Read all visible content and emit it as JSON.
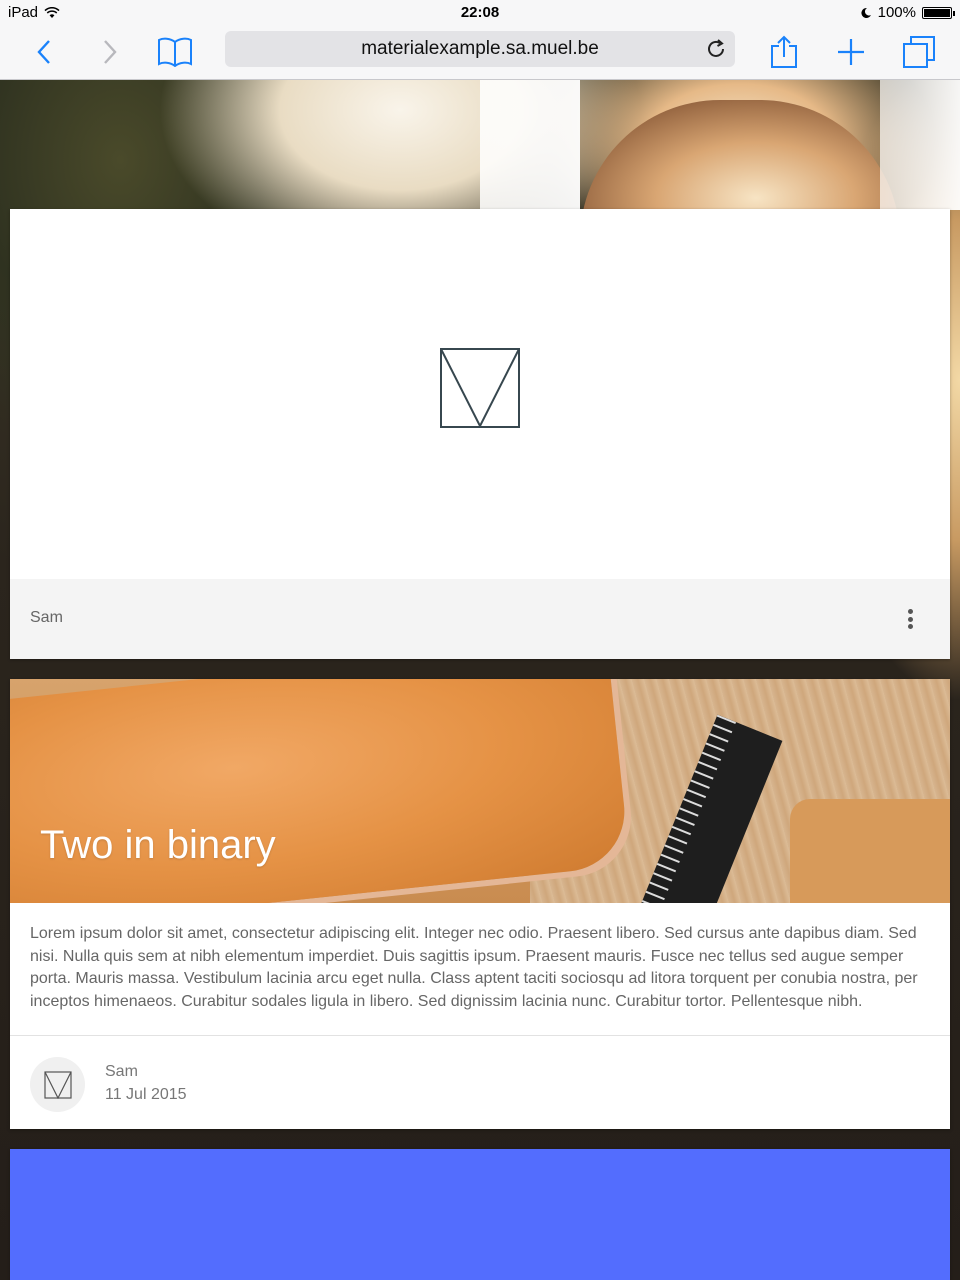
{
  "status_bar": {
    "device": "iPad",
    "time": "22:08",
    "battery": "100%",
    "battery_level": 1.0
  },
  "browser": {
    "url": "materialexample.sa.muel.be",
    "accent_color": "#1a82fb"
  },
  "cards": {
    "first": {
      "author": "Sam"
    },
    "second": {
      "title": "Two in binary",
      "excerpt": "Lorem ipsum dolor sit amet, consectetur adipiscing elit. Integer nec odio. Praesent libero. Sed cursus ante dapibus diam. Sed nisi. Nulla quis sem at nibh elementum imperdiet. Duis sagittis ipsum. Praesent mauris. Fusce nec tellus sed augue semper porta. Mauris massa. Vestibulum lacinia arcu eget nulla. Class aptent taciti sociosqu ad litora torquent per conubia nostra, per inceptos himenaeos. Curabitur sodales ligula in libero. Sed dignissim lacinia nunc. Curabitur tortor. Pellentesque nibh.",
      "author": "Sam",
      "date": "11 Jul 2015"
    },
    "third": {
      "color": "#536dfe"
    }
  }
}
